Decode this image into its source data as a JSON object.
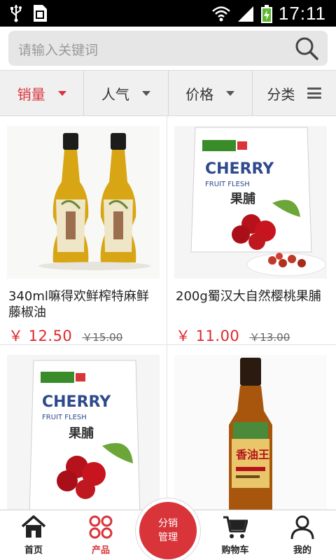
{
  "status_bar": {
    "time": "17:11"
  },
  "search": {
    "placeholder": "请输入关键词"
  },
  "filters": [
    {
      "label": "销量",
      "active": true
    },
    {
      "label": "人气",
      "active": false
    },
    {
      "label": "价格",
      "active": false
    },
    {
      "label": "分类",
      "active": false
    }
  ],
  "products": [
    {
      "title": "340ml嘛得欢鲜榨特麻鲜藤椒油",
      "price": "￥ 12.50",
      "old_price": "￥15.00",
      "image": "pepper-oil-bottles"
    },
    {
      "title": "200g蜀汉大自然樱桃果脯",
      "price": "￥ 11.00",
      "old_price": "￥13.00",
      "image": "cherry-fruit-flesh-bag"
    },
    {
      "title": "",
      "price": "",
      "old_price": "",
      "image": "cherry-fruit-flesh-bag"
    },
    {
      "title": "",
      "price": "",
      "old_price": "",
      "image": "sesame-oil-bottle"
    }
  ],
  "package_text": {
    "brand": "CHERRY",
    "sub": "FRUIT FLESH",
    "cn": "果脯",
    "label_cn": "香油王"
  },
  "bottom_nav": {
    "home": "首页",
    "products": "产品",
    "center_line1": "分销",
    "center_line2": "管理",
    "cart": "购物车",
    "mine": "我的"
  },
  "colors": {
    "accent": "#d8343a",
    "price": "#e0282e",
    "status_bar": "#000000",
    "search_bg": "#e6e6e6"
  }
}
